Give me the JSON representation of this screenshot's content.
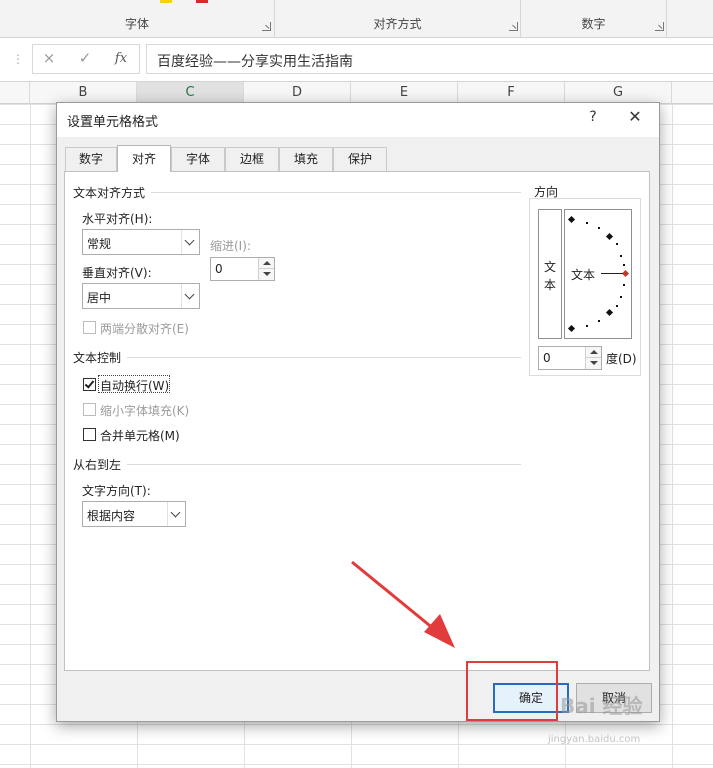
{
  "ribbon": {
    "groups": [
      "字体",
      "对齐方式",
      "数字"
    ]
  },
  "formula_bar": {
    "cancel_icon": "×",
    "confirm_icon": "✓",
    "fx_label": "fx",
    "content": "百度经验——分享实用生活指南"
  },
  "columns": [
    "B",
    "C",
    "D",
    "E",
    "F",
    "G"
  ],
  "dialog": {
    "title": "设置单元格格式",
    "help": "?",
    "close": "✕",
    "tabs": [
      "数字",
      "对齐",
      "字体",
      "边框",
      "填充",
      "保护"
    ],
    "active_tab": "对齐",
    "text_alignment": {
      "section_title": "文本对齐方式",
      "horizontal_label": "水平对齐(H):",
      "horizontal_value": "常规",
      "indent_label": "缩进(I):",
      "indent_value": "0",
      "vertical_label": "垂直对齐(V):",
      "vertical_value": "居中",
      "justify_distributed_label": "两端分散对齐(E)"
    },
    "text_control": {
      "section_title": "文本控制",
      "wrap_text_label": "自动换行(W)",
      "wrap_text_checked": true,
      "shrink_to_fit_label": "缩小字体填充(K)",
      "merge_cells_label": "合并单元格(M)"
    },
    "right_to_left": {
      "section_title": "从右到左",
      "direction_label": "文字方向(T):",
      "direction_value": "根据内容"
    },
    "orientation": {
      "title": "方向",
      "vertical_text_1": "文",
      "vertical_text_2": "本",
      "dial_text": "文本",
      "degrees_value": "0",
      "degrees_label": "度(D)"
    },
    "buttons": {
      "ok": "确定",
      "cancel": "取消"
    }
  },
  "watermark": {
    "brand": "Bai 经验",
    "url": "jingyan.baidu.com"
  },
  "colors": {
    "annotation_red": "#e23b3b",
    "excel_green": "#217346",
    "default_button_border": "#2a6bbf"
  }
}
